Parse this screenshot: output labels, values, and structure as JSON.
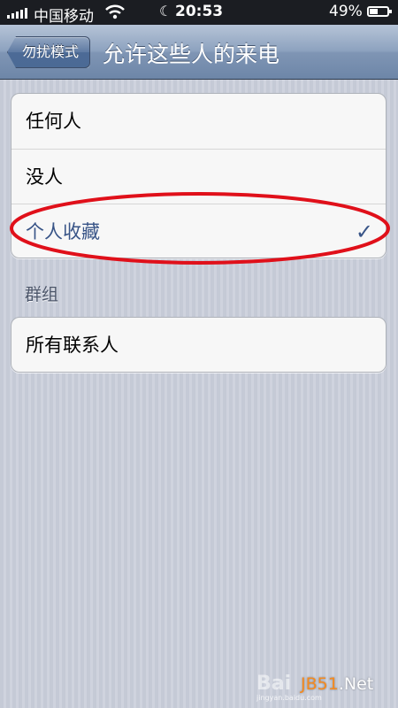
{
  "status_bar": {
    "carrier": "中国移动",
    "time": "20:53",
    "battery_percent": "49%",
    "battery_level": 0.49,
    "signal_bars": 5,
    "wifi_icon": "wifi-icon",
    "moon_icon": "do-not-disturb-moon-icon"
  },
  "nav": {
    "back_label": "勿扰模式",
    "title": "允许这些人的来电"
  },
  "options": [
    {
      "label": "任何人",
      "selected": false
    },
    {
      "label": "没人",
      "selected": false
    },
    {
      "label": "个人收藏",
      "selected": true
    }
  ],
  "checkmark": "✓",
  "groups": {
    "header": "群组",
    "items": [
      {
        "label": "所有联系人"
      }
    ]
  },
  "annotation": {
    "color": "#e0101a"
  },
  "watermark": {
    "brand": "Bai",
    "site": "JB51",
    "site_suffix": ".Net",
    "sub": "jingyan.baidu.com"
  },
  "colors": {
    "nav_gradient_top": "#b6c4d7",
    "nav_gradient_bottom": "#6d86a8",
    "selected_text": "#385487",
    "accent_orange": "#f58a1f"
  }
}
